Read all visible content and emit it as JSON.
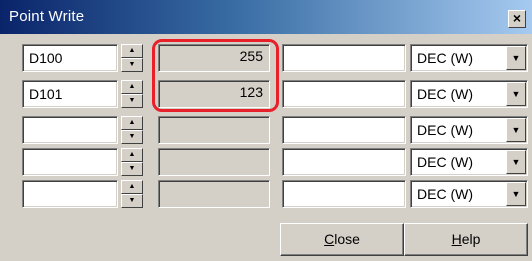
{
  "window": {
    "title": "Point Write",
    "close_glyph": "×"
  },
  "rows": [
    {
      "address": "D100",
      "value": "255",
      "input": "",
      "format": "DEC (W)"
    },
    {
      "address": "D101",
      "value": "123",
      "input": "",
      "format": "DEC (W)"
    },
    {
      "address": "",
      "value": "",
      "input": "",
      "format": "DEC (W)"
    },
    {
      "address": "",
      "value": "",
      "input": "",
      "format": "DEC (W)"
    },
    {
      "address": "",
      "value": "",
      "input": "",
      "format": "DEC (W)"
    }
  ],
  "buttons": {
    "close": {
      "accel": "C",
      "rest": "lose"
    },
    "help": {
      "accel": "H",
      "rest": "elp"
    }
  },
  "colors": {
    "highlight": "#e8202a",
    "face": "#d4d0c8",
    "title_start": "#0a246a",
    "title_end": "#a6caf0"
  },
  "icons": {
    "spin_up": "up-arrow-icon",
    "spin_down": "down-arrow-icon",
    "dropdown": "dropdown-arrow-icon"
  }
}
